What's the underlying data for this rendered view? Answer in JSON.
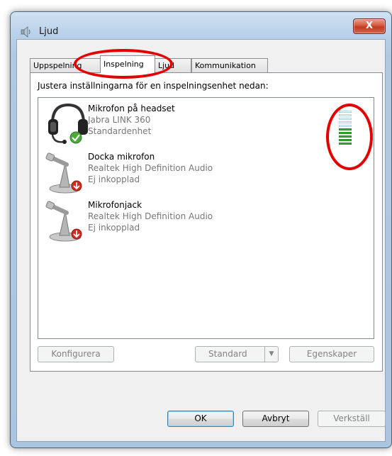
{
  "window": {
    "title": "Ljud",
    "close_label": "X"
  },
  "tabs": [
    {
      "label": "Uppspelning",
      "active": false
    },
    {
      "label": "Inspelning",
      "active": true
    },
    {
      "label": "Ljud",
      "active": false
    },
    {
      "label": "Kommunikation",
      "active": false
    }
  ],
  "panel": {
    "instruction": "Justera inställningarna för en inspelningsenhet nedan:"
  },
  "devices": [
    {
      "name": "Mikrofon på headset",
      "driver": "Jabra LINK 360",
      "status": "Standardenhet",
      "icon": "headset-icon",
      "badge": "check-badge-icon",
      "level_active_segments": 5,
      "level_total_segments": 10
    },
    {
      "name": "Docka mikrofon",
      "driver": "Realtek High Definition Audio",
      "status": "Ej inkopplad",
      "icon": "microphone-icon",
      "badge": "down-arrow-badge-icon"
    },
    {
      "name": "Mikrofonjack",
      "driver": "Realtek High Definition Audio",
      "status": "Ej inkopplad",
      "icon": "microphone-icon",
      "badge": "down-arrow-badge-icon"
    }
  ],
  "buttons": {
    "configure": "Konfigurera",
    "standard": "Standard",
    "properties": "Egenskaper",
    "ok": "OK",
    "cancel": "Avbryt",
    "apply": "Verkställ"
  },
  "colors": {
    "annotation_red": "#e20000",
    "level_green": "#3bae3b",
    "title_close_red": "#c23a23"
  }
}
